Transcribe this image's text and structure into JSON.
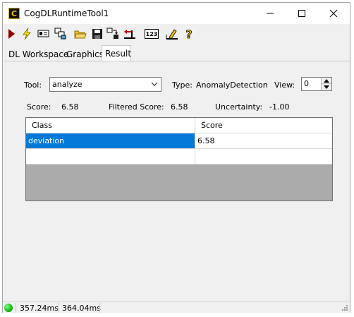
{
  "window": {
    "title": "CogDLRuntimeTool1"
  },
  "toolbar": {
    "buttons": [
      {
        "icon": "run-arrow-icon"
      },
      {
        "icon": "lightning-icon"
      },
      {
        "icon": "display-icon"
      },
      {
        "icon": "layers-icon"
      },
      {
        "icon": "open-folder-icon"
      },
      {
        "icon": "save-disk-icon"
      },
      {
        "icon": "transfer-icon"
      },
      {
        "icon": "import-icon"
      },
      {
        "icon": "counter-icon",
        "text": "123"
      },
      {
        "icon": "edit-icon"
      },
      {
        "icon": "help-icon",
        "text": "?"
      }
    ]
  },
  "tabs": [
    {
      "label": "DL Workspace",
      "active": false
    },
    {
      "label": "Graphics",
      "active": false
    },
    {
      "label": "Result",
      "active": true
    }
  ],
  "result": {
    "tool_label": "Tool:",
    "tool_value": "analyze",
    "type_label": "Type:",
    "type_value": "AnomalyDetection",
    "view_label": "View:",
    "view_value": "0",
    "score_label": "Score:",
    "score_value": "6.58",
    "filtered_label": "Filtered Score:",
    "filtered_value": "6.58",
    "uncertainty_label": "Uncertainty:",
    "uncertainty_value": "-1.00"
  },
  "grid": {
    "columns": [
      "Class",
      "Score"
    ],
    "rows": [
      {
        "class": "deviation",
        "score": "6.58",
        "selected": true
      },
      {
        "class": "",
        "score": "",
        "selected": false
      }
    ]
  },
  "status": {
    "indicator_color": "#10c010",
    "time1": "357.24ms",
    "time2": "364.04ms"
  },
  "colors": {
    "selection": "#0078d7",
    "grid_empty": "#ababab"
  }
}
